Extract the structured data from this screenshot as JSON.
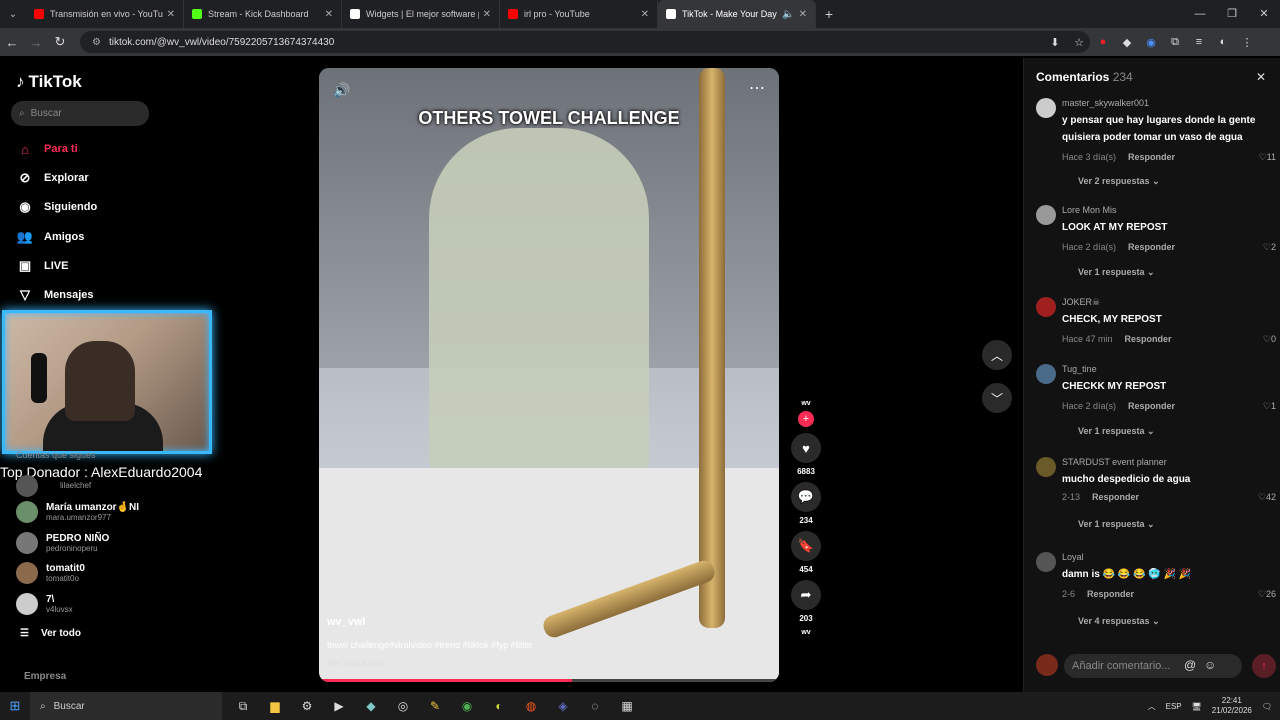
{
  "tabs": [
    {
      "title": "Transmisión en vivo - YouTube",
      "color": "#ff0000"
    },
    {
      "title": "Stream - Kick Dashboard",
      "color": "#53fc18"
    },
    {
      "title": "Widgets | El mejor software pa",
      "color": "#ffffff"
    },
    {
      "title": "irl pro - YouTube",
      "color": "#ff0000"
    },
    {
      "title": "TikTok - Make Your Day",
      "color": "#ffffff",
      "active": true
    }
  ],
  "address": {
    "url": "tiktok.com/@wv_vwl/video/7592205713674374430"
  },
  "sidebar": {
    "logo": "TikTok",
    "search_placeholder": "Buscar",
    "menu": [
      {
        "label": "Para ti",
        "icon": "home-icon"
      },
      {
        "label": "Explorar",
        "icon": "compass-icon"
      },
      {
        "label": "Siguiendo",
        "icon": "following-icon"
      },
      {
        "label": "Amigos",
        "icon": "friends-icon"
      },
      {
        "label": "LIVE",
        "icon": "live-icon"
      },
      {
        "label": "Mensajes",
        "icon": "messages-icon"
      }
    ],
    "following_title": "Cuentas que sigues",
    "accounts": [
      {
        "name": "",
        "handle": "lilaelchef"
      },
      {
        "name": "María umanzor🤞NI",
        "handle": "mara.umanzor977"
      },
      {
        "name": "PEDRO NIÑO",
        "handle": "pedroninoperu"
      },
      {
        "name": "tomatit0",
        "handle": "tomatit0o"
      },
      {
        "name": "7\\",
        "handle": "v4luvsx"
      }
    ],
    "see_all": "Ver todo",
    "company": "Empresa"
  },
  "overlay": {
    "donor": "Top Donador : AlexEduardo2004"
  },
  "video": {
    "title": "OTHERS TOWEL CHALLENGE",
    "user": "wv_vwl",
    "description": "towel challenge#viralvideo #trend #tiktok #fyp #filter",
    "translate": "Ver traducción",
    "progress": 0.55
  },
  "actions": {
    "avatar_label": "wv",
    "likes": "6883",
    "comments": "234",
    "saves": "454",
    "shares": "203",
    "bottom_label": "wv"
  },
  "comments": {
    "title": "Comentarios",
    "count": "234",
    "items": [
      {
        "user": "master_skywalker001",
        "text": "y pensar que hay lugares donde la gente quisiera poder tomar un vaso de agua",
        "time": "Hace 3 día(s)",
        "reply": "Responder",
        "likes": "11",
        "replies": "Ver 2 respuestas"
      },
      {
        "user": "Lore Mon Mis",
        "text": "LOOK AT MY REPOST",
        "time": "Hace 2 día(s)",
        "reply": "Responder",
        "likes": "2",
        "replies": "Ver 1 respuesta"
      },
      {
        "user": "JOKER☠",
        "text": "CHECK, MY REPOST",
        "time": "Hace 47 min",
        "reply": "Responder",
        "likes": "0",
        "replies": ""
      },
      {
        "user": "Tug_tine",
        "text": "CHECKK MY REPOST",
        "time": "Hace 2 día(s)",
        "reply": "Responder",
        "likes": "1",
        "replies": "Ver 1 respuesta"
      },
      {
        "user": "STARDUST event planner",
        "text": "mucho despedicio de agua",
        "time": "2-13",
        "reply": "Responder",
        "likes": "42",
        "replies": "Ver 1 respuesta"
      },
      {
        "user": "Loyal",
        "text": "damn is 😂 😂 😂 🥶 🎉 🎉",
        "time": "2-6",
        "reply": "Responder",
        "likes": "26",
        "replies": "Ver 4 respuestas"
      }
    ],
    "input_placeholder": "Añadir comentario..."
  },
  "taskbar": {
    "search": "Buscar",
    "lang": "ESP",
    "time": "22:41",
    "date": "21/02/2026"
  }
}
